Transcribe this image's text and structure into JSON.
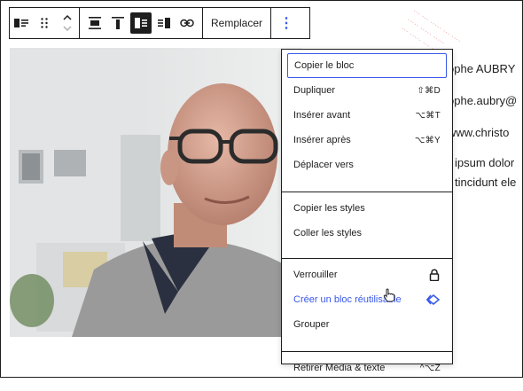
{
  "toolbar": {
    "replace_label": "Remplacer",
    "more_label": "⋮"
  },
  "content": {
    "lines": [
      "ophe AUBRY",
      "ophe.aubry@",
      "www.christo",
      "ipsum dolor",
      "tincidunt ele"
    ]
  },
  "menu": {
    "group1": [
      {
        "label": "Copier le bloc",
        "shortcut": ""
      },
      {
        "label": "Dupliquer",
        "shortcut": "⇧⌘D"
      },
      {
        "label": "Insérer avant",
        "shortcut": "⌥⌘T"
      },
      {
        "label": "Insérer après",
        "shortcut": "⌥⌘Y"
      },
      {
        "label": "Déplacer vers",
        "shortcut": ""
      }
    ],
    "group2": [
      {
        "label": "Copier les styles"
      },
      {
        "label": "Coller les styles"
      }
    ],
    "group3": [
      {
        "label": "Verrouiller",
        "icon": "lock-icon"
      },
      {
        "label": "Créer un bloc réutilisable",
        "icon": "reusable-block-icon"
      },
      {
        "label": "Grouper"
      }
    ],
    "group4": [
      {
        "label": "Retirer Média & texte",
        "shortcut": "^⌥Z"
      }
    ]
  },
  "colors": {
    "accent": "#3858e9",
    "text": "#1e1e1e"
  }
}
